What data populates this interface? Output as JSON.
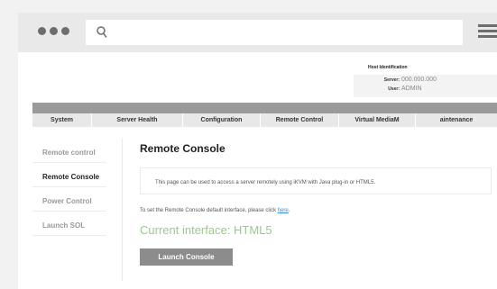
{
  "browser": {
    "url_value": "",
    "icons": [
      "window-dots-icon",
      "search-icon",
      "menu-icon"
    ]
  },
  "host": {
    "title": "Host Identification",
    "server_label": "Server:",
    "server_value": "000.000.000",
    "user_label": "User:",
    "user_value": "ADMIN"
  },
  "nav": {
    "items": [
      "System",
      "Server Health",
      "Configuration",
      "Remote Control",
      "Virtual MediaM",
      "aintenance"
    ]
  },
  "sidebar": {
    "items": [
      "Remote control",
      "Remote Console",
      "Power Control",
      "Launch SOL"
    ],
    "active_index": 1
  },
  "main": {
    "title": "Remote Console",
    "description": "This page can be used to access a server remotely using iKVM with Java plug-in or HTML5.",
    "note_prefix": "To set the Remote Console default interface, please click ",
    "note_link": "here",
    "note_suffix": ".",
    "current_interface": "Current interface: HTML5",
    "launch_button": "Launch Console"
  },
  "colors": {
    "accent_green": "#9ac98e",
    "link_blue": "#3e8ed0",
    "button_grey": "#8c8c8c",
    "band_grey": "#9a9a9a"
  }
}
